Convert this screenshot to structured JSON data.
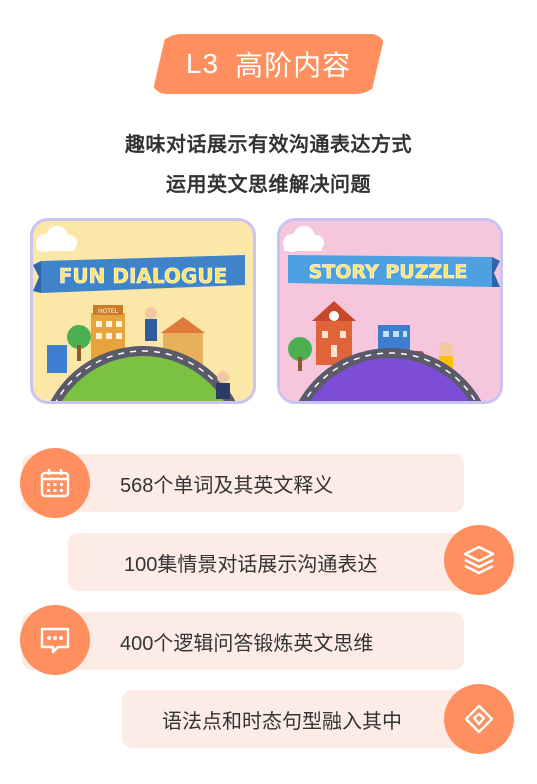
{
  "header": {
    "level": "L3",
    "title": "高阶内容"
  },
  "description": {
    "line1": "趣味对话展示有效沟通表达方式",
    "line2": "运用英文思维解决问题"
  },
  "cards": [
    {
      "banner": "FUN DIALOGUE",
      "sign": "HOTEL"
    },
    {
      "banner": "STORY PUZZLE"
    }
  ],
  "features": [
    {
      "text": "568个单词及其英文释义",
      "icon": "calendar-icon"
    },
    {
      "text": "100集情景对话展示沟通表达",
      "icon": "layers-icon"
    },
    {
      "text": "400个逻辑问答锻炼英文思维",
      "icon": "chat-bubble-icon"
    },
    {
      "text": "语法点和时态句型融入其中",
      "icon": "diamond-tag-icon"
    }
  ],
  "colors": {
    "accent": "#ff8f5e",
    "pill_bg": "#fdece6",
    "card_border": "#c9c3f4"
  }
}
